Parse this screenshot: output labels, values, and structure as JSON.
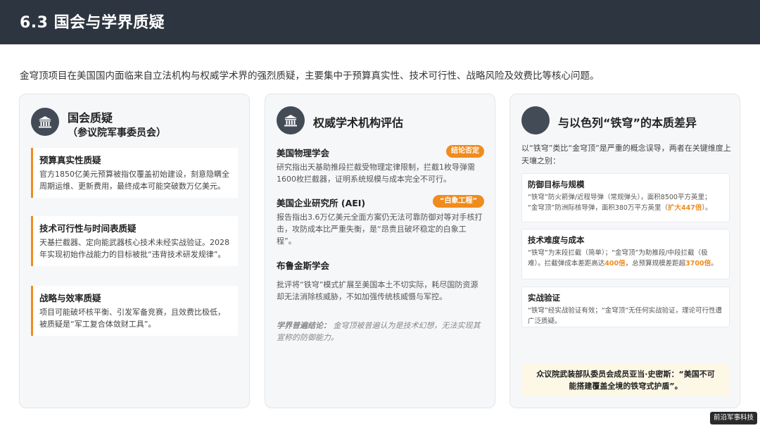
{
  "header": {
    "title": "6.3 国会与学界质疑"
  },
  "intro": "金穹顶项目在美国国内面临来自立法机构与权威学术界的强烈质疑，主要集中于预算真实性、技术可行性、战略风险及效费比等核心问题。",
  "colors": {
    "header_bg": "#2d3540",
    "accent": "#f08c1e",
    "icon_circle": "#434b57",
    "card_bg": "#f6f7f9",
    "quote_bg": "#fdf8e6"
  },
  "card1": {
    "icon": "capitol-building-icon",
    "title": "国会质疑",
    "subtitle": "（参议院军事委员会）",
    "issues": [
      {
        "title": "预算真实性质疑",
        "body": "官方1850亿美元预算被指仅覆盖初始建设，刻意隐瞒全周期运维、更新费用，最终成本可能突破数万亿美元。"
      },
      {
        "title": "技术可行性与时间表质疑",
        "body": "天基拦截器、定向能武器核心技术未经实战验证。2028年实现初始作战能力的目标被批“违背技术研发规律”。"
      },
      {
        "title": "战略与效率质疑",
        "body": "项目可能破坏核平衡、引发军备竞赛，且效费比极低，被质疑是“军工复合体敛财工具”。"
      }
    ]
  },
  "card2": {
    "icon": "institution-building-icon",
    "title": "权威学术机构评估",
    "orgs": [
      {
        "name": "美国物理学会",
        "badge": "结论否定",
        "desc": "研究指出天基助推段拦截受物理定律限制，拦截1枚导弹需1600枚拦截器，证明系统规模与成本完全不可行。"
      },
      {
        "name": "美国企业研究所 (AEI)",
        "badge": "“白象工程”",
        "desc": "报告指出3.6万亿美元全面方案仍无法可靠防御对等对手核打击，攻防成本比严重失衡，是“昂贵且破坏稳定的白象工程”。"
      },
      {
        "name": "布鲁金斯学会",
        "badge": "",
        "desc": "批评将“铁穹”模式扩展至美国本土不切实际，耗尽国防资源却无法消除核威胁，不如加强传统核威慑与军控。"
      }
    ],
    "conclusion_label": "学界普遍结论：",
    "conclusion_text": "金穹顶被普遍认为是技术幻想，无法实现其宣称的防御能力。"
  },
  "card3": {
    "icon": "dark-circle-icon",
    "title": "与以色列“铁穹”的本质差异",
    "intro": "以“铁穹”类比“金穹顶”是严重的概念误导，两者在关键维度上天壤之别：",
    "diffs": [
      {
        "title": "防御目标与规模",
        "line1": "“铁穹”防火箭弹/近程导弹（常规弹头），面积8500平方英里；",
        "line2_pre": "“金穹顶”防洲际核导弹，面积380万平方英里（",
        "line2_hl": "扩大447倍",
        "line2_post": "）。"
      },
      {
        "title": "技术难度与成本",
        "text_pre": "“铁穹”为末段拦截（简单）；“金穹顶”为助推段/中段拦截（极难）。拦截弹成本差距高达",
        "hl1": "400倍",
        "text_mid": "，总预算规模差距超",
        "hl2": "3700倍",
        "text_post": "。"
      },
      {
        "title": "实战验证",
        "body": "“铁穹”经实战验证有效；“金穹顶”无任何实战验证，理论可行性遭广泛质疑。"
      }
    ],
    "quote_line1": "众议院武装部队委员会成员亚当·史密斯：“美国不可",
    "quote_line2": "能搭建覆盖全境的铁穹式护盾”。"
  },
  "watermark": "前沿军事科技"
}
